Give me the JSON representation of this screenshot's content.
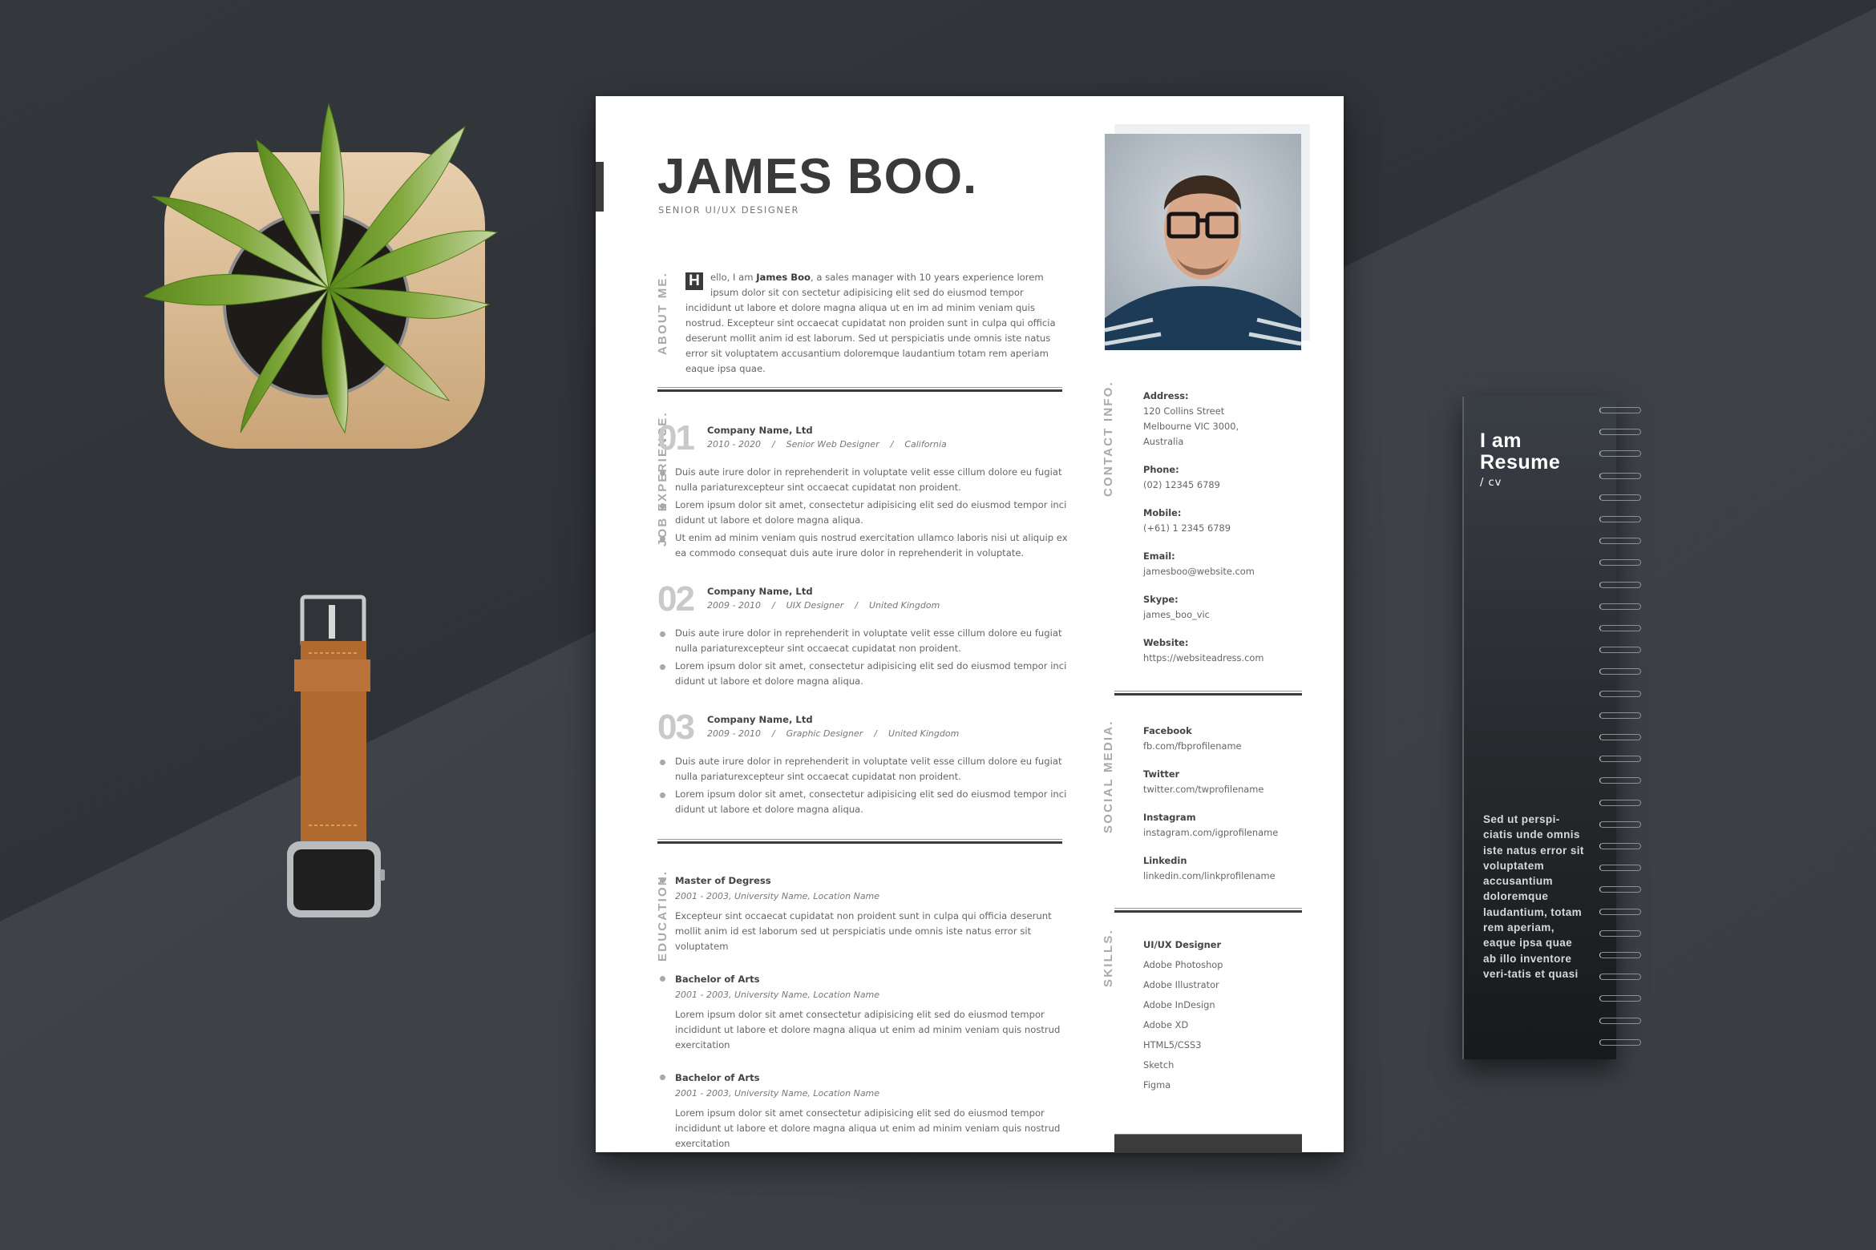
{
  "resume": {
    "name": "JAMES BOO.",
    "title": "SENIOR UI/UX DESIGNER",
    "about": {
      "label": "ABOUT ME.",
      "dropcap": "H",
      "intro_pre": "ello, I am ",
      "intro_name": "James Boo",
      "intro_post": ", a sales manager with 10 years experience lorem ipsum dolor sit con sectetur adipisicing elit sed do eiusmod tempor incididunt ut labore et dolore magna aliqua ut en im ad minim veniam quis nostrud. Excepteur sint occaecat cupidatat non proiden sunt in culpa qui officia deserunt mollit anim id est laborum. Sed ut perspiciatis unde omnis iste natus error sit voluptatem accusantium doloremque laudantium totam rem aperiam eaque ipsa quae."
    },
    "experience": {
      "label": "JOB EXPERIENCE.",
      "jobs": [
        {
          "number": "01",
          "company": "Company Name, Ltd",
          "years": "2010 - 2020",
          "role": "Senior Web Designer",
          "location": "California",
          "bullets": [
            "Duis aute irure dolor in reprehenderit in voluptate velit esse cillum dolore eu fugiat nulla pariaturexcepteur sint occaecat cupidatat non proident.",
            "Lorem ipsum dolor sit amet, consectetur adipisicing elit sed do eiusmod tempor inci didunt ut labore et dolore magna aliqua.",
            "Ut enim ad minim veniam quis nostrud exercitation ullamco laboris nisi ut aliquip ex ea commodo consequat duis aute irure dolor in reprehenderit in voluptate."
          ]
        },
        {
          "number": "02",
          "company": "Company Name, Ltd",
          "years": "2009 - 2010",
          "role": "UIX Designer",
          "location": "United Kingdom",
          "bullets": [
            "Duis aute irure dolor in reprehenderit in voluptate velit esse cillum dolore eu fugiat nulla pariaturexcepteur sint occaecat cupidatat non proident.",
            "Lorem ipsum dolor sit amet, consectetur adipisicing elit sed do eiusmod tempor inci didunt ut labore et dolore magna aliqua."
          ]
        },
        {
          "number": "03",
          "company": "Company Name, Ltd",
          "years": "2009 - 2010",
          "role": "Graphic Designer",
          "location": "United Kingdom",
          "bullets": [
            "Duis aute irure dolor in reprehenderit in voluptate velit esse cillum dolore eu fugiat nulla pariaturexcepteur sint occaecat cupidatat non proident.",
            "Lorem ipsum dolor sit amet, consectetur adipisicing elit sed do eiusmod tempor inci didunt ut labore et dolore magna aliqua."
          ]
        }
      ]
    },
    "education": {
      "label": "EDUCATION.",
      "items": [
        {
          "title": "Master of Degress",
          "meta": "2001 - 2003, University Name, Location Name",
          "desc": "Excepteur sint occaecat cupidatat non proident sunt in culpa qui officia deserunt mollit anim id est laborum sed ut perspiciatis unde omnis iste natus error sit voluptatem"
        },
        {
          "title": "Bachelor of Arts",
          "meta": "2001 - 2003, University Name, Location Name",
          "desc": "Lorem ipsum dolor sit amet consectetur adipisicing elit sed do eiusmod tempor incididunt ut labore et dolore magna aliqua ut enim ad minim veniam quis nostrud exercitation"
        },
        {
          "title": "Bachelor of Arts",
          "meta": "2001 - 2003, University Name, Location Name",
          "desc": "Lorem ipsum dolor sit amet consectetur adipisicing elit sed do eiusmod tempor incididunt ut labore et dolore magna aliqua ut enim ad minim veniam quis nostrud exercitation"
        }
      ]
    },
    "contact": {
      "label": "CONTACT INFO.",
      "items": [
        {
          "label": "Address:",
          "value": "120 Collins Street\nMelbourne VIC 3000,\nAustralia"
        },
        {
          "label": "Phone:",
          "value": "(02) 12345 6789"
        },
        {
          "label": "Mobile:",
          "value": "(+61) 1 2345 6789"
        },
        {
          "label": "Email:",
          "value": "jamesboo@website.com"
        },
        {
          "label": "Skype:",
          "value": "james_boo_vic"
        },
        {
          "label": "Website:",
          "value": "https://websiteadress.com"
        }
      ]
    },
    "social": {
      "label": "SOCIAL MEDIA.",
      "items": [
        {
          "label": "Facebook",
          "value": "fb.com/fbprofilename"
        },
        {
          "label": "Twitter",
          "value": "twitter.com/twprofilename"
        },
        {
          "label": "Instagram",
          "value": "instagram.com/igprofilename"
        },
        {
          "label": "Linkedin",
          "value": "linkedin.com/linkprofilename"
        }
      ]
    },
    "skills": {
      "label": "SKILLS.",
      "items": [
        "UI/UX Designer",
        "Adobe Photoshop",
        "Adobe Illustrator",
        "Adobe InDesign",
        "Adobe XD",
        "HTML5/CSS3",
        "Sketch",
        "Figma"
      ]
    }
  },
  "notebook": {
    "title_line1": "I am",
    "title_line2": "Resume",
    "subtitle": "/ cv",
    "body": "Sed ut perspi-ciatis unde omnis iste natus error sit voluptatem accusantium doloremque laudantium, totam rem aperiam, eaque ipsa quae ab illo inventore veri-tatis et quasi"
  },
  "colors": {
    "background_dark": "#2e3136",
    "background_light": "#3f4348",
    "page": "#ffffff",
    "ink": "#3a3a3a",
    "muted": "#a9a9a9",
    "strap": "#b0692e"
  }
}
